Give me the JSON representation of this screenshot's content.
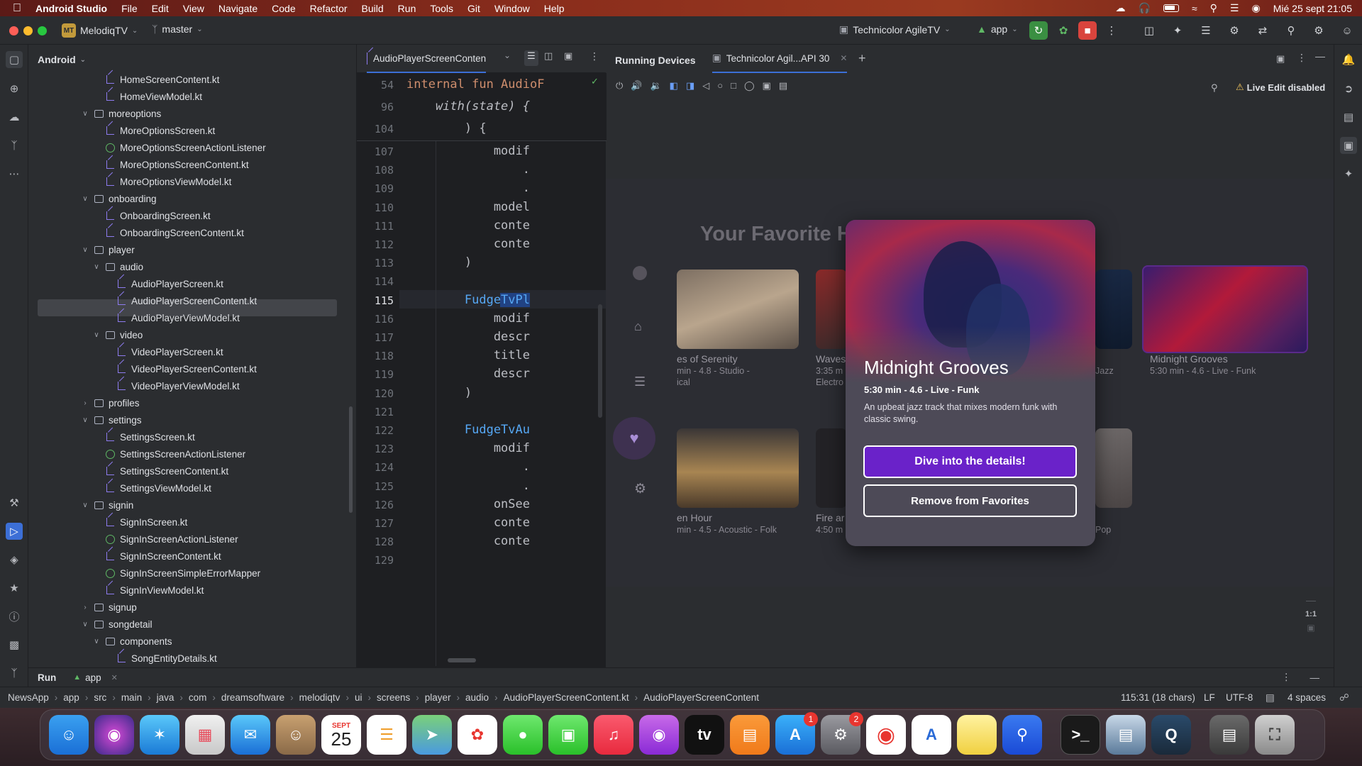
{
  "menubar": {
    "app_name": "Android Studio",
    "items": [
      "File",
      "Edit",
      "View",
      "Navigate",
      "Code",
      "Refactor",
      "Build",
      "Run",
      "Tools",
      "Git",
      "Window",
      "Help"
    ],
    "datetime": "Mié 25 sept 21:05"
  },
  "toolbar": {
    "project_badge": "MT",
    "project_name": "MelodiqTV",
    "branch": "master",
    "device": "Technicolor AgileTV",
    "run_config": "app"
  },
  "project_panel": {
    "title": "Android",
    "tree": [
      {
        "label": "HomeScreenContent.kt",
        "type": "kt"
      },
      {
        "label": "HomeViewModel.kt",
        "type": "kt"
      },
      {
        "label": "moreoptions",
        "type": "folder"
      },
      {
        "label": "MoreOptionsScreen.kt",
        "type": "kt"
      },
      {
        "label": "MoreOptionsScreenActionListener",
        "type": "iface"
      },
      {
        "label": "MoreOptionsScreenContent.kt",
        "type": "kt"
      },
      {
        "label": "MoreOptionsViewModel.kt",
        "type": "kt"
      },
      {
        "label": "onboarding",
        "type": "folder"
      },
      {
        "label": "OnboardingScreen.kt",
        "type": "kt"
      },
      {
        "label": "OnboardingScreenContent.kt",
        "type": "kt"
      },
      {
        "label": "player",
        "type": "folder"
      },
      {
        "label": "audio",
        "type": "folder"
      },
      {
        "label": "AudioPlayerScreen.kt",
        "type": "kt"
      },
      {
        "label": "AudioPlayerScreenContent.kt",
        "type": "kt"
      },
      {
        "label": "AudioPlayerViewModel.kt",
        "type": "kt"
      },
      {
        "label": "video",
        "type": "folder"
      },
      {
        "label": "VideoPlayerScreen.kt",
        "type": "kt"
      },
      {
        "label": "VideoPlayerScreenContent.kt",
        "type": "kt"
      },
      {
        "label": "VideoPlayerViewModel.kt",
        "type": "kt"
      },
      {
        "label": "profiles",
        "type": "folder"
      },
      {
        "label": "settings",
        "type": "folder"
      },
      {
        "label": "SettingsScreen.kt",
        "type": "kt"
      },
      {
        "label": "SettingsScreenActionListener",
        "type": "iface"
      },
      {
        "label": "SettingsScreenContent.kt",
        "type": "kt"
      },
      {
        "label": "SettingsViewModel.kt",
        "type": "kt"
      },
      {
        "label": "signin",
        "type": "folder"
      },
      {
        "label": "SignInScreen.kt",
        "type": "kt"
      },
      {
        "label": "SignInScreenActionListener",
        "type": "iface"
      },
      {
        "label": "SignInScreenContent.kt",
        "type": "kt"
      },
      {
        "label": "SignInScreenSimpleErrorMapper",
        "type": "iface"
      },
      {
        "label": "SignInViewModel.kt",
        "type": "kt"
      },
      {
        "label": "signup",
        "type": "folder"
      },
      {
        "label": "songdetail",
        "type": "folder"
      },
      {
        "label": "components",
        "type": "folder"
      },
      {
        "label": "SongEntityDetails.kt",
        "type": "kt"
      }
    ]
  },
  "editor": {
    "tab": "AudioPlayerScreenConten",
    "lines": [
      {
        "n": "54",
        "code": "internal fun AudioF"
      },
      {
        "n": "96",
        "code": "    with(state) {"
      },
      {
        "n": "104",
        "code": "        ) {"
      },
      {
        "n": "107",
        "code": "            modif"
      },
      {
        "n": "108",
        "code": "                ."
      },
      {
        "n": "109",
        "code": "                ."
      },
      {
        "n": "110",
        "code": "            model"
      },
      {
        "n": "111",
        "code": "            conte"
      },
      {
        "n": "112",
        "code": "            conte"
      },
      {
        "n": "113",
        "code": "        )"
      },
      {
        "n": "114",
        "code": ""
      },
      {
        "n": "115",
        "code": "        FudgeTvPl"
      },
      {
        "n": "116",
        "code": "            modif"
      },
      {
        "n": "117",
        "code": "            descr"
      },
      {
        "n": "118",
        "code": "            title"
      },
      {
        "n": "119",
        "code": "            descr"
      },
      {
        "n": "120",
        "code": "        )"
      },
      {
        "n": "121",
        "code": ""
      },
      {
        "n": "122",
        "code": "        FudgeTvAu"
      },
      {
        "n": "123",
        "code": "            modif"
      },
      {
        "n": "124",
        "code": "                ."
      },
      {
        "n": "125",
        "code": "                ."
      },
      {
        "n": "126",
        "code": "            onSee"
      },
      {
        "n": "127",
        "code": "            conte"
      },
      {
        "n": "128",
        "code": "            conte"
      },
      {
        "n": "129",
        "code": ""
      }
    ]
  },
  "running_devices": {
    "title": "Running Devices",
    "device_tab": "Technicolor Agil...API 30",
    "live_edit": "Live Edit disabled",
    "zoom_label": "1:1"
  },
  "tv_app": {
    "heading": "Your Favorite H",
    "cards": [
      {
        "title": "es of Serenity",
        "meta": "min  - 4.8 - Studio -",
        "meta2": "ical"
      },
      {
        "title": "Waves",
        "meta": "3:35 m",
        "meta2": "Electro"
      },
      {
        "title": "",
        "meta": "Jazz",
        "meta2": ""
      },
      {
        "title": "Midnight Grooves",
        "meta": "5:30 min  - 4.6 - Live - Funk",
        "meta2": ""
      },
      {
        "title": "en Hour",
        "meta": "min  - 4.5 - Acoustic - Folk",
        "meta2": ""
      },
      {
        "title": "Fire ar",
        "meta": "4:50 m",
        "meta2": ""
      },
      {
        "title": "",
        "meta": "Pop",
        "meta2": ""
      }
    ],
    "popup": {
      "title": "Midnight Grooves",
      "meta": "5:30 min  - 4.6 - Live - Funk",
      "description": "An upbeat jazz track that mixes modern funk with classic swing.",
      "primary_button": "Dive into the details!",
      "secondary_button": "Remove from Favorites"
    }
  },
  "runbar": {
    "label": "Run",
    "config": "app"
  },
  "statusbar": {
    "breadcrumbs": [
      "NewsApp",
      "app",
      "src",
      "main",
      "java",
      "com",
      "dreamsoftware",
      "melodiqtv",
      "ui",
      "screens",
      "player",
      "audio",
      "AudioPlayerScreenContent.kt",
      "AudioPlayerScreenContent"
    ],
    "position": "115:31 (18 chars)",
    "line_sep": "LF",
    "encoding": "UTF-8",
    "indent": "4 spaces"
  },
  "dock": {
    "calendar_month": "SEPT",
    "calendar_day": "25",
    "appstore_badge": "1",
    "settings_badge": "2"
  }
}
